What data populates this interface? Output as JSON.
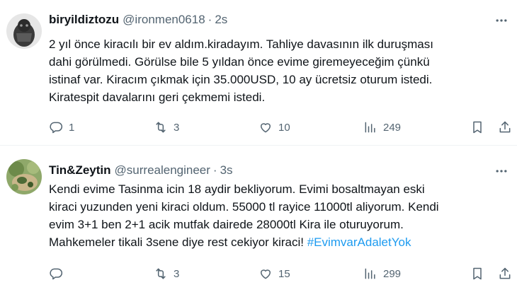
{
  "tweets": [
    {
      "display_name": "biryildiztozu",
      "handle": "@ironmen0618",
      "separator": "·",
      "time": "2s",
      "lines": [
        "2 yıl önce kiracılı bir ev aldım.kiradayım. Tahliye davasının ilk duruşması",
        "dahi görülmedi. Görülse bile 5 yıldan önce evime giremeyeceğim çünkü",
        "istinaf var. Kiracım çıkmak için 35.000USD, 10 ay ücretsiz oturum istedi.",
        "Kiratespit davalarını geri çekmemi istedi."
      ],
      "replies": "1",
      "reposts": "3",
      "likes": "10",
      "views": "249"
    },
    {
      "display_name": "Tin&Zeytin",
      "handle": "@surrealengineer",
      "separator": "·",
      "time": "3s",
      "lines": [
        "Kendi evime Tasinma icin 18 aydir bekliyorum. Evimi bosaltmayan eski",
        "kiraci yuzunden yeni kiraci oldum. 55000 tl rayice 11000tl aliyorum. Kendi",
        "evim 3+1 ben 2+1 acik mutfak dairede 28000tl Kira ile oturuyorum."
      ],
      "last_line_text": "Mahkemeler tikali 3sene diye rest cekiyor kiraci! ",
      "hashtag": "#EvimvarAdaletYok",
      "replies": "",
      "reposts": "3",
      "likes": "15",
      "views": "299"
    }
  ],
  "colors": {
    "text": "#0f1419",
    "secondary": "#536471",
    "link": "#1d9bf0",
    "divider": "#eff3f4"
  },
  "icons": [
    "more-icon",
    "reply-icon",
    "repost-icon",
    "like-icon",
    "views-icon",
    "bookmark-icon",
    "share-icon"
  ]
}
